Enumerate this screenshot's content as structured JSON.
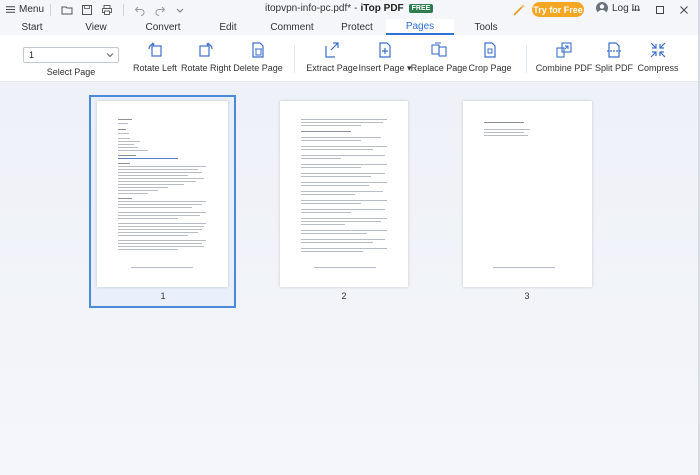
{
  "titlebar": {
    "menu_label": "Menu",
    "doc_name": "itopvpn-info-pc.pdf*",
    "separator": "-",
    "app_name": "iTop PDF",
    "free_badge": "FREE",
    "try_label": "Try for Free",
    "login_label": "Log In"
  },
  "tabs": [
    {
      "label": "Start"
    },
    {
      "label": "View"
    },
    {
      "label": "Convert"
    },
    {
      "label": "Edit"
    },
    {
      "label": "Comment"
    },
    {
      "label": "Protect"
    },
    {
      "label": "Pages",
      "active": true
    },
    {
      "label": "Tools"
    }
  ],
  "ribbon": {
    "page_select_value": "1",
    "select_page_label": "Select Page",
    "buttons": [
      {
        "label": "Rotate Left",
        "icon": "rotate-left-icon"
      },
      {
        "label": "Rotate Right",
        "icon": "rotate-right-icon"
      },
      {
        "label": "Delete Page",
        "icon": "delete-page-icon"
      },
      {
        "label": "Extract Page",
        "icon": "extract-page-icon"
      },
      {
        "label": "Insert Page",
        "icon": "insert-page-icon"
      },
      {
        "label": "Replace Page",
        "icon": "replace-page-icon"
      },
      {
        "label": "Crop Page",
        "icon": "crop-page-icon"
      },
      {
        "label": "Combine PDF",
        "icon": "combine-pdf-icon"
      },
      {
        "label": "Split PDF",
        "icon": "split-pdf-icon"
      },
      {
        "label": "Compress",
        "icon": "compress-icon"
      }
    ]
  },
  "pages": [
    {
      "number": "1",
      "selected": true
    },
    {
      "number": "2",
      "selected": false
    },
    {
      "number": "3",
      "selected": false
    }
  ],
  "colors": {
    "accent": "#2f6fd6",
    "try_button": "#f5a623",
    "free_badge": "#2e7d4f",
    "selection_border": "#4a8ad9"
  }
}
